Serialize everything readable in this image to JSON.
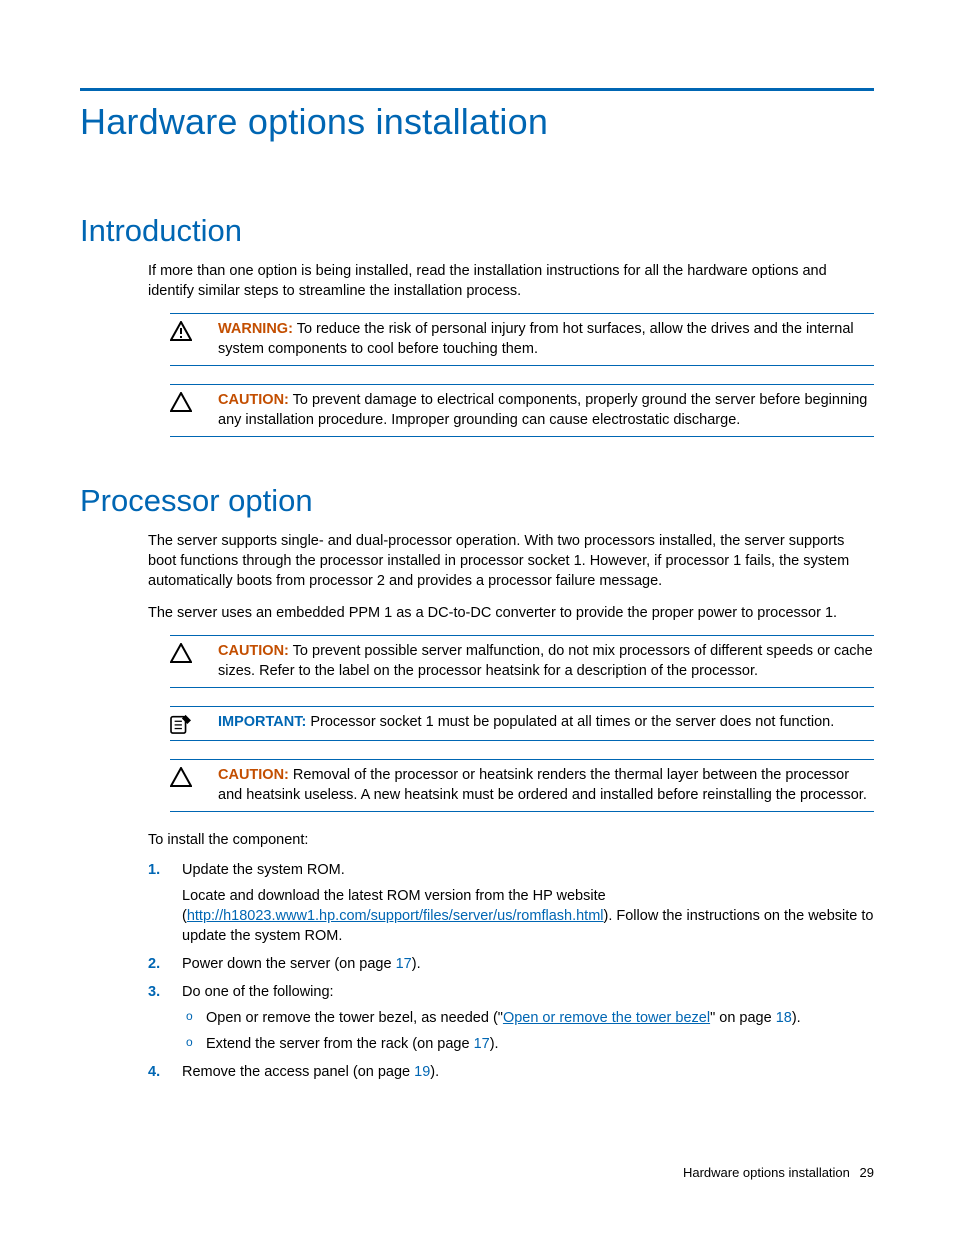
{
  "title": "Hardware options installation",
  "intro": {
    "heading": "Introduction",
    "p1": "If more than one option is being installed, read the installation instructions for all the hardware options and identify similar steps to streamline the installation process.",
    "warn_label": "WARNING:",
    "warn_text": "  To reduce the risk of personal injury from hot surfaces, allow the drives and the internal system components to cool before touching them.",
    "caution_label": "CAUTION:",
    "caution_text": "  To prevent damage to electrical components, properly ground the server before beginning any installation procedure. Improper grounding can cause electrostatic discharge."
  },
  "proc": {
    "heading": "Processor option",
    "p1": "The server supports single- and dual-processor operation. With two processors installed, the server supports boot functions through the processor installed in processor socket 1. However, if processor 1 fails, the system automatically boots from processor 2 and provides a processor failure message.",
    "p2": "The server uses an embedded PPM 1 as a DC-to-DC converter to provide the proper power to processor 1.",
    "c1_label": "CAUTION:",
    "c1_text": "  To prevent possible server malfunction, do not mix processors of different speeds or cache sizes. Refer to the label on the processor heatsink for a description of the processor.",
    "imp_label": "IMPORTANT:",
    "imp_text": "  Processor socket 1 must be populated at all times or the server does not function.",
    "c2_label": "CAUTION:",
    "c2_text": "  Removal of the processor or heatsink renders the thermal layer between the processor and heatsink useless. A new heatsink must be ordered and installed before reinstalling the processor.",
    "lead": "To install the component:",
    "s1": "Update the system ROM.",
    "s1b_a": "Locate and download the latest ROM version from the HP website (",
    "s1b_link": "http://h18023.www1.hp.com/support/files/server/us/romflash.html",
    "s1b_b": "). Follow the instructions on the website to update the system ROM.",
    "s2a": "Power down the server (on page ",
    "s2p": "17",
    "s2b": ").",
    "s3": "Do one of the following:",
    "s3o1a": "Open or remove the tower bezel, as needed (\"",
    "s3o1link": "Open or remove the tower bezel",
    "s3o1b": "\" on page ",
    "s3o1p": "18",
    "s3o1c": ").",
    "s3o2a": "Extend the server from the rack (on page ",
    "s3o2p": "17",
    "s3o2b": ").",
    "s4a": "Remove the access panel (on page ",
    "s4p": "19",
    "s4b": ")."
  },
  "footer": {
    "section": "Hardware options installation",
    "page": "29"
  }
}
